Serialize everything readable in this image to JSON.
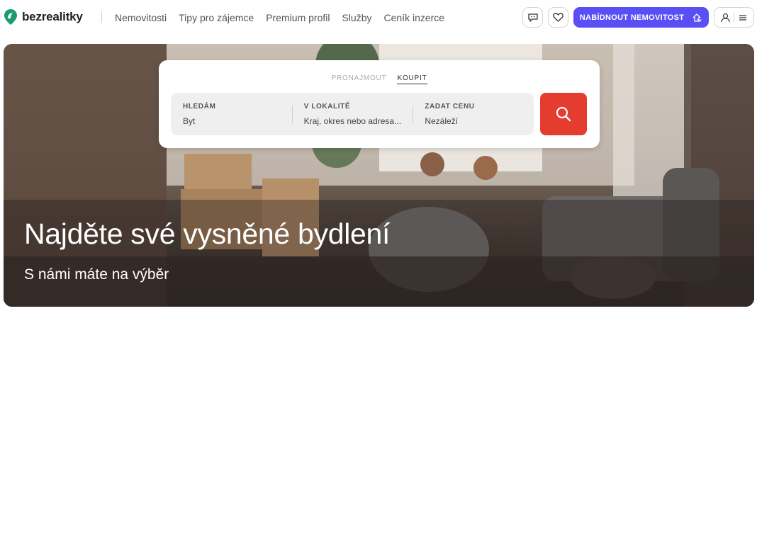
{
  "header": {
    "logo_text": "bezrealitky",
    "nav": [
      "Nemovitosti",
      "Tipy pro zájemce",
      "Premium profil",
      "Služby",
      "Ceník inzerce"
    ],
    "offer_button": "NABÍDNOUT NEMOVITOST"
  },
  "hero": {
    "title": "Najděte své vysněné bydlení",
    "subtitle": "S námi máte na výběr"
  },
  "search": {
    "tabs": [
      "PRONAJMOUT",
      "KOUPIT"
    ],
    "active_tab": "KOUPIT",
    "fields": [
      {
        "label": "HLEDÁM",
        "value": "Byt"
      },
      {
        "label": "V LOKALITĚ",
        "value": "Kraj, okres nebo adresa..."
      },
      {
        "label": "ZADAT CENU",
        "value": "Nezáleží"
      }
    ]
  },
  "colors": {
    "brand_green": "#1a9b6c",
    "offer_button": "#5a4ff5",
    "search_button": "#e43d2f"
  },
  "icons": [
    "logo-icon",
    "chat-icon",
    "heart-icon",
    "home-hand-icon",
    "user-icon",
    "menu-icon",
    "search-icon"
  ]
}
